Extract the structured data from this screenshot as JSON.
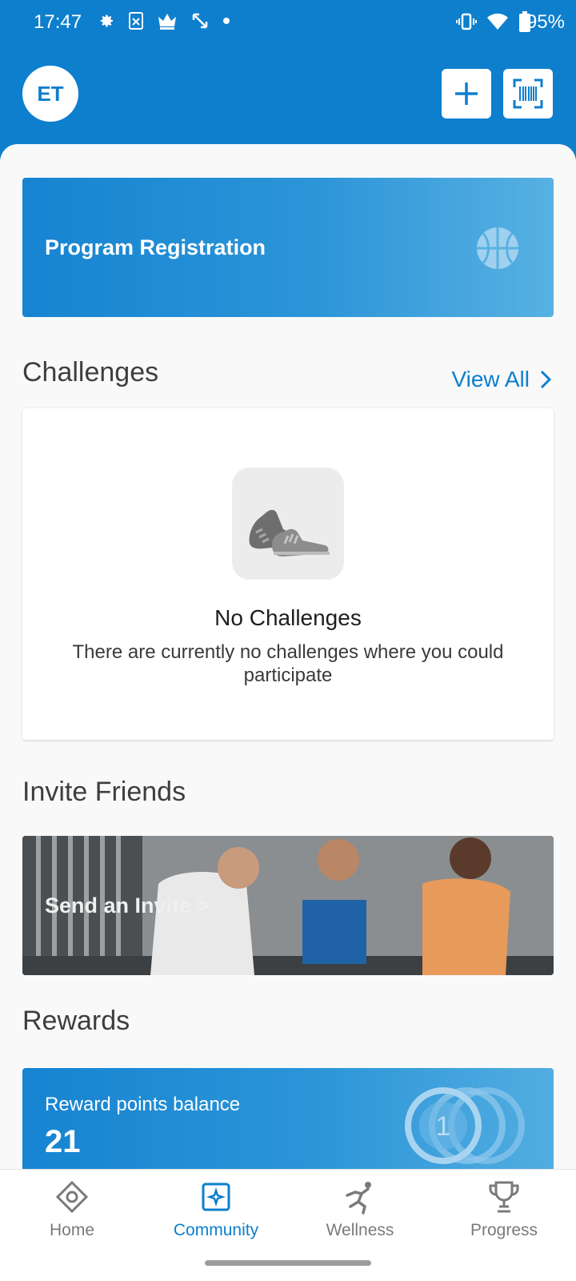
{
  "status_bar": {
    "time": "17:47",
    "battery": "95%",
    "left_icons": [
      "settings-icon",
      "sim-icon",
      "crown-icon",
      "expand-icon",
      "dot-icon"
    ],
    "right_icons": [
      "vibrate-icon",
      "wifi-icon",
      "battery-icon"
    ]
  },
  "header": {
    "avatar_initials": "ET",
    "add_button": "plus-icon",
    "scan_button": "barcode-scan-icon"
  },
  "program_registration": {
    "label": "Program Registration",
    "icon": "basketball-icon"
  },
  "challenges": {
    "title": "Challenges",
    "view_all": "View All",
    "empty_title": "No Challenges",
    "empty_text": "There are currently no challenges where you could participate",
    "empty_icon": "sneakers-icon"
  },
  "invite_friends": {
    "title": "Invite Friends",
    "cta": "Send an Invite >"
  },
  "rewards": {
    "title": "Rewards",
    "label": "Reward points balance",
    "value": "21",
    "coin_number": "1"
  },
  "bottom_nav": {
    "items": [
      {
        "label": "Home",
        "icon": "home-diamond-icon",
        "active": false
      },
      {
        "label": "Community",
        "icon": "community-icon",
        "active": true
      },
      {
        "label": "Wellness",
        "icon": "runner-icon",
        "active": false
      },
      {
        "label": "Progress",
        "icon": "trophy-icon",
        "active": false
      }
    ]
  },
  "colors": {
    "primary": "#0d7fcd",
    "background": "#f9f9fa",
    "text_dark": "#3e3e3e"
  }
}
